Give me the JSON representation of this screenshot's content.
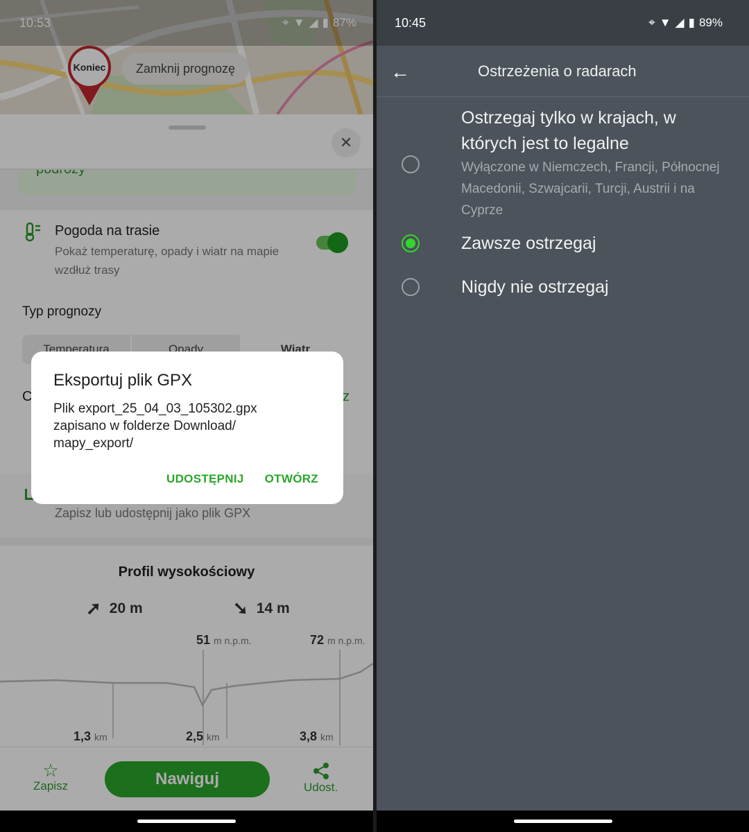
{
  "left": {
    "status": {
      "time": "10:53",
      "battery": "87%"
    },
    "map": {
      "pin_label": "Koniec",
      "chip_label": "Zamknij prognozę"
    },
    "green_card_text": "podróży",
    "weather": {
      "title": "Pogoda na trasie",
      "subtitle": "Pokaż temperaturę, opady i wiatr na mapie wzdłuż trasy",
      "enabled": true
    },
    "forecast": {
      "label": "Typ prognozy",
      "options": [
        "Temperatura",
        "Opady",
        "Wiatr"
      ],
      "selected": "Wiatr"
    },
    "hidden_left_letter": "C",
    "hidden_right_letter": "z",
    "export_subtitle": "Zapisz lub udostępnij jako plik GPX",
    "profile": {
      "title": "Profil wysokościowy",
      "ascent": "20 m",
      "descent": "14 m",
      "alt_values": [
        {
          "value": "51",
          "unit": "m n.p.m."
        },
        {
          "value": "72",
          "unit": "m n.p.m."
        }
      ],
      "km_values": [
        {
          "value": "1,3",
          "unit": "km"
        },
        {
          "value": "2,5",
          "unit": "km"
        },
        {
          "value": "3,8",
          "unit": "km"
        }
      ]
    },
    "bottom": {
      "save_label": "Zapisz",
      "navigate_label": "Nawiguj",
      "share_label": "Udost."
    },
    "dialog": {
      "title": "Eksportuj plik GPX",
      "message": "Plik export_25_04_03_105302.gpx zapisano w folderze Download/ mapy_export/",
      "share": "UDOSTĘPNIJ",
      "open": "OTWÓRZ"
    }
  },
  "right": {
    "status": {
      "time": "10:45",
      "battery": "89%"
    },
    "appbar_title": "Ostrzeżenia o radarach",
    "options": [
      {
        "title": "Ostrzegaj tylko w krajach, w których jest to legalne",
        "subtitle": "Wyłączone w Niemczech, Francji, Północnej Macedonii, Szwajcarii, Turcji, Austrii i na Cyprze",
        "selected": false
      },
      {
        "title": "Zawsze ostrzegaj",
        "subtitle": "",
        "selected": true
      },
      {
        "title": "Nigdy nie ostrzegaj",
        "subtitle": "",
        "selected": false
      }
    ]
  }
}
